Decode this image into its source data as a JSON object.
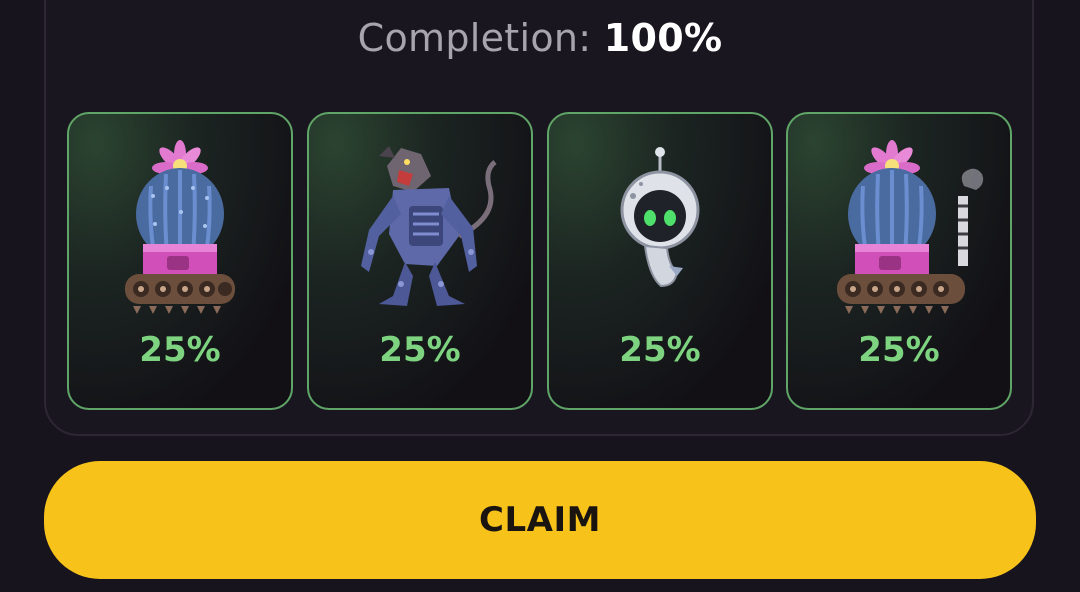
{
  "completion": {
    "label": "Completion:",
    "value": "100%"
  },
  "cards": [
    {
      "name": "cactus-tank",
      "percent": "25%",
      "icon": "cactus-tank-icon"
    },
    {
      "name": "robot-rat",
      "percent": "25%",
      "icon": "robot-rat-icon"
    },
    {
      "name": "astro-bot",
      "percent": "25%",
      "icon": "astro-bot-icon"
    },
    {
      "name": "cactus-tank-exhaust",
      "percent": "25%",
      "icon": "cactus-tank-exhaust-icon"
    }
  ],
  "claim_button": {
    "label": "CLAIM"
  },
  "colors": {
    "accent": "#f7c31a",
    "card_border": "#5fa567",
    "percent_text": "#7dd380",
    "background": "#18141d"
  }
}
